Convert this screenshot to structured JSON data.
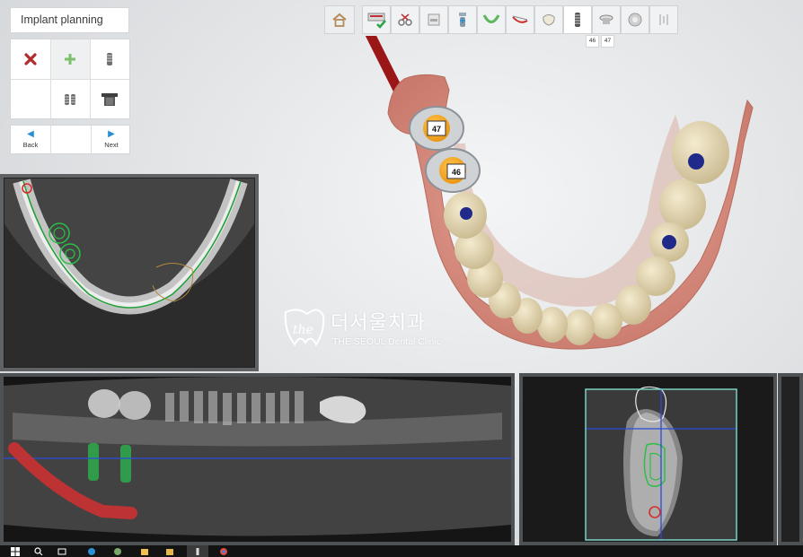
{
  "panel": {
    "title": "Implant planning",
    "tools": [
      {
        "icon": "delete-x-icon"
      },
      {
        "icon": "add-plus-icon"
      },
      {
        "icon": "implant-icon"
      },
      {
        "icon": "blank"
      },
      {
        "icon": "implant-pair-icon"
      },
      {
        "icon": "abutment-sleeve-icon"
      }
    ],
    "nav": {
      "back_label": "Back",
      "next_label": "Next"
    }
  },
  "toolbar": {
    "steps": [
      "home-icon",
      "scan-data-icon",
      "tools-icon",
      "document-icon",
      "implant-plus-icon",
      "arch-icon",
      "jaw-cut-icon",
      "crown-icon",
      "implant-step-icon",
      "sleeve-icon",
      "drill-guide-icon",
      "export-icon"
    ],
    "active_step": "implant-step-icon",
    "tooth_badges": [
      "46",
      "47"
    ]
  },
  "model3d": {
    "implant_labels": [
      "47",
      "46"
    ]
  },
  "logo": {
    "mark": "the",
    "korean": "더서울치과",
    "english": "THE SEOUL Dental Clinic"
  },
  "colors": {
    "accent_blue": "#2a8fd0",
    "implant_orange": "#f5a623",
    "nerve_red": "#c41f1f",
    "guide_green": "#36c24a"
  }
}
